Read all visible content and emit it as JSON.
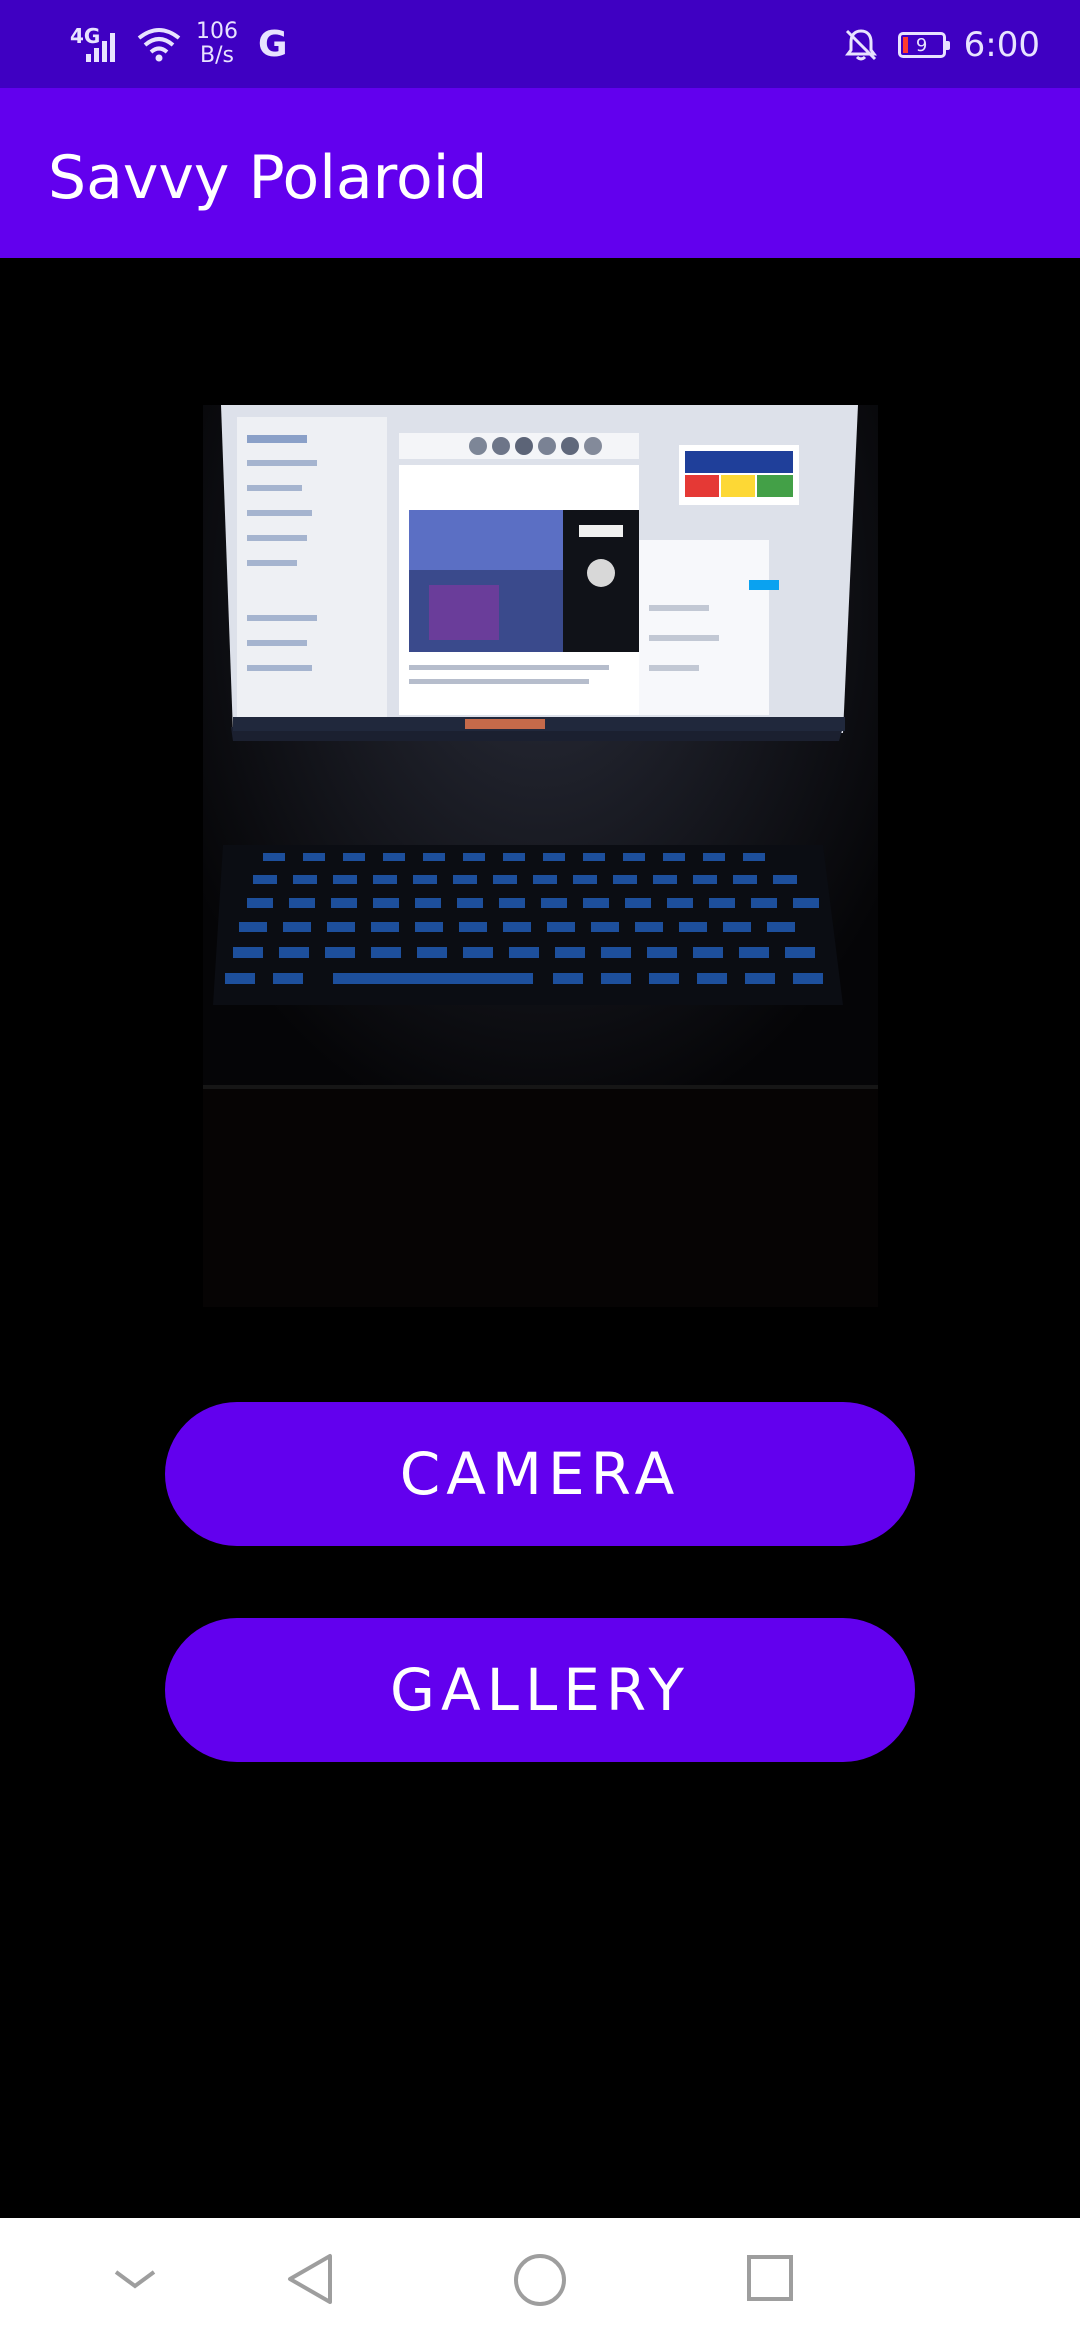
{
  "status_bar": {
    "network_type": "4G",
    "speed_value": "106",
    "speed_unit": "B/s",
    "battery_level": "9",
    "time": "6:00",
    "icons": [
      "signal-icon",
      "wifi-icon",
      "google-icon",
      "notifications-off-icon",
      "battery-icon"
    ]
  },
  "app_bar": {
    "title": "Savvy Polaroid"
  },
  "preview": {
    "type": "photo"
  },
  "buttons": {
    "camera_label": "CAMERA",
    "gallery_label": "GALLERY"
  },
  "nav_bar": {
    "icons": [
      "chevron-down-icon",
      "back-icon",
      "home-icon",
      "recents-icon"
    ]
  },
  "colors": {
    "status_bar": "#3f00c2",
    "primary": "#6200ee",
    "background": "#000000",
    "nav_bar": "#ffffff"
  }
}
